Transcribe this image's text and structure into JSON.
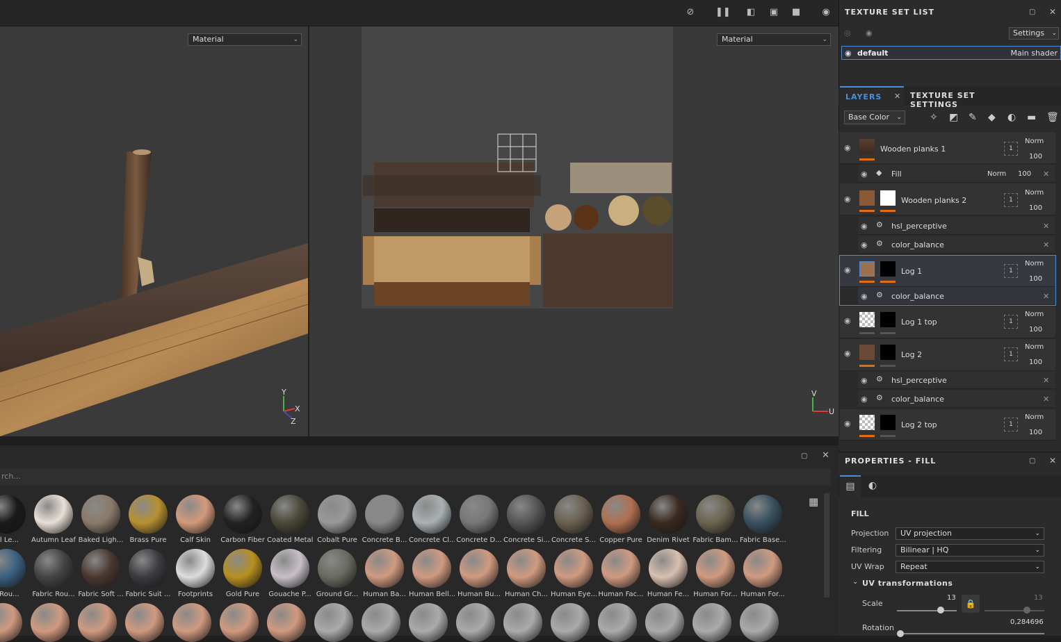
{
  "viewport3d": {
    "material_select": "Material",
    "axis_y": "Y",
    "axis_x": "X",
    "axis_z": "Z"
  },
  "viewport2d": {
    "material_select": "Material",
    "axis_v": "V",
    "axis_u": "U"
  },
  "shelf": {
    "search_placeholder": "rch...",
    "row1": [
      "ial Le...",
      "Autumn Leaf",
      "Baked Ligh...",
      "Brass Pure",
      "Calf Skin",
      "Carbon Fiber",
      "Coated Metal",
      "Cobalt Pure",
      "Concrete B...",
      "Concrete Cl...",
      "Concrete D...",
      "Concrete Si...",
      "Concrete S...",
      "Copper Pure",
      "Denim Rivet",
      "Fabric Bam...",
      "Fabric Base..."
    ],
    "row2": [
      "c Rou...",
      "Fabric Rou...",
      "Fabric Soft ...",
      "Fabric Suit ...",
      "Footprints",
      "Gold Pure",
      "Gouache P...",
      "Ground Gr...",
      "Human Ba...",
      "Human Bell...",
      "Human Bu...",
      "Human Ch...",
      "Human Eye...",
      "Human Fac...",
      "Human Fe...",
      "Human For...",
      "Human For..."
    ]
  },
  "texture_set_list": {
    "title": "TEXTURE SET LIST",
    "settings_label": "Settings",
    "set_name": "default",
    "set_shader": "Main shader"
  },
  "layers_panel": {
    "tab_layers": "LAYERS",
    "tab_texture_settings": "TEXTURE SET SETTINGS",
    "channel_select": "Base Color",
    "layers": [
      {
        "name": "Wooden planks 1",
        "blend": "Norm",
        "opacity": "100",
        "count": "1"
      },
      {
        "name": "Wooden planks 2",
        "blend": "Norm",
        "opacity": "100",
        "count": "1"
      },
      {
        "name": "Log 1",
        "blend": "Norm",
        "opacity": "100",
        "count": "1"
      },
      {
        "name": "Log 1 top",
        "blend": "Norm",
        "opacity": "100",
        "count": "1"
      },
      {
        "name": "Log 2",
        "blend": "Norm",
        "opacity": "100",
        "count": "1"
      },
      {
        "name": "Log 2 top",
        "blend": "Norm",
        "opacity": "100",
        "count": "1"
      }
    ],
    "fill_sub": {
      "name": "Fill",
      "blend": "Norm",
      "opacity": "100"
    },
    "effects": {
      "hsl": "hsl_perceptive",
      "color_balance": "color_balance"
    }
  },
  "properties": {
    "title": "PROPERTIES - FILL",
    "section": "FILL",
    "projection_label": "Projection",
    "projection_value": "UV projection",
    "filtering_label": "Filtering",
    "filtering_value": "Bilinear | HQ",
    "uvwrap_label": "UV Wrap",
    "uvwrap_value": "Repeat",
    "uvtrans_label": "UV transformations",
    "scale_label": "Scale",
    "scale_value": "13",
    "scale_value2": "13",
    "rotation_label": "Rotation",
    "rotation_value": "0,284696"
  }
}
